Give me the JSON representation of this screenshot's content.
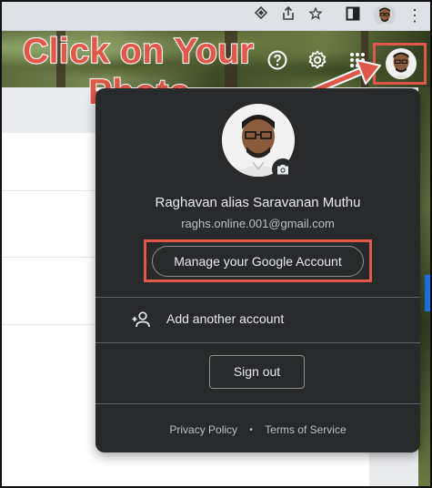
{
  "annotation": {
    "line1": "Click on Your",
    "line2": "Photo",
    "color": "#e0584a"
  },
  "toolbar": {
    "icons": [
      "extension-diamond-icon",
      "share-icon",
      "star-icon",
      "sidebar-icon",
      "profile-avatar",
      "more-vert-icon"
    ]
  },
  "header": {
    "icons": [
      "help-icon",
      "settings-icon",
      "apps-grid-icon",
      "account-avatar"
    ]
  },
  "account": {
    "name": "Raghavan alias Saravanan Muthu",
    "email": "raghs.online.001@gmail.com",
    "manage_label": "Manage your Google Account",
    "add_label": "Add another account",
    "signout_label": "Sign out",
    "privacy_label": "Privacy Policy",
    "separator": "•",
    "terms_label": "Terms of Service"
  },
  "colors": {
    "popup_bg": "#28292a",
    "highlight": "#e0584a",
    "toolbar_bg": "#dee1e6"
  }
}
